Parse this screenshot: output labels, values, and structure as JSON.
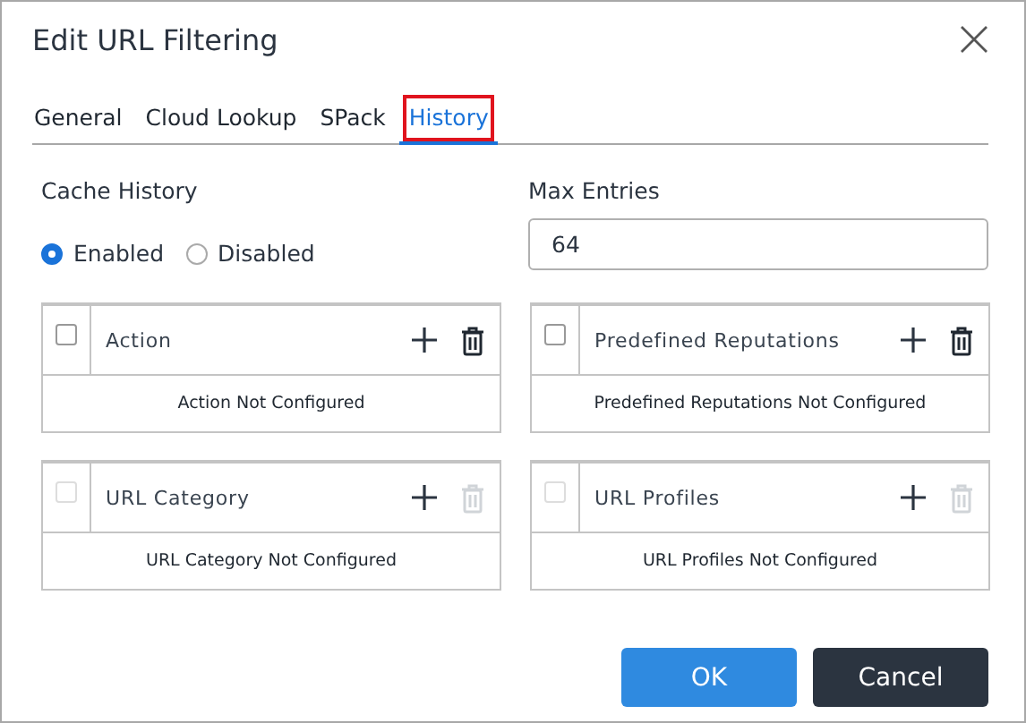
{
  "window": {
    "title": "Edit URL Filtering"
  },
  "tabs": [
    {
      "label": "General",
      "selected": false,
      "highlighted": false
    },
    {
      "label": "Cloud Lookup",
      "selected": false,
      "highlighted": false
    },
    {
      "label": "SPack",
      "selected": false,
      "highlighted": false
    },
    {
      "label": "History",
      "selected": true,
      "highlighted": true
    }
  ],
  "cache_history": {
    "label": "Cache History",
    "options": [
      {
        "label": "Enabled",
        "selected": true
      },
      {
        "label": "Disabled",
        "selected": false
      }
    ]
  },
  "max_entries": {
    "label": "Max Entries",
    "value": "64"
  },
  "tables": [
    {
      "title": "Action",
      "empty_text": "Action Not Configured",
      "checked": false,
      "disabled": false
    },
    {
      "title": "Predefined Reputations",
      "empty_text": "Predefined Reputations Not Configured",
      "checked": false,
      "disabled": false
    },
    {
      "title": "URL Category",
      "empty_text": "URL Category Not Configured",
      "checked": false,
      "disabled": true
    },
    {
      "title": "URL Profiles",
      "empty_text": "URL Profiles Not Configured",
      "checked": false,
      "disabled": true
    }
  ],
  "buttons": [
    {
      "label": "OK",
      "kind": "primary"
    },
    {
      "label": "Cancel",
      "kind": "secondary"
    }
  ]
}
